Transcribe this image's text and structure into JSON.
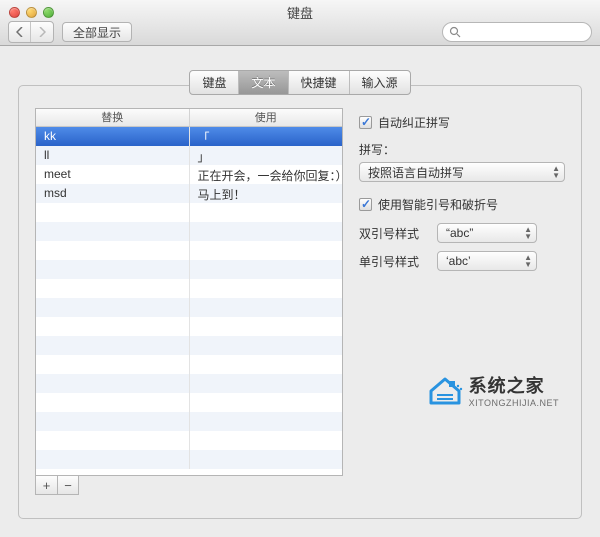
{
  "window": {
    "title": "键盘",
    "showall": "全部显示",
    "search_placeholder": ""
  },
  "tabs": [
    "键盘",
    "文本",
    "快捷键",
    "输入源"
  ],
  "active_tab_index": 1,
  "table": {
    "headers": [
      "替换",
      "使用"
    ],
    "rows": [
      {
        "replace": "kk",
        "use": "「"
      },
      {
        "replace": "ll",
        "use": "」"
      },
      {
        "replace": "meet",
        "use": "正在开会，一会给你回复：）"
      },
      {
        "replace": "msd",
        "use": "马上到！"
      }
    ],
    "selected_index": 0
  },
  "right": {
    "autocorrect_label": "自动纠正拼写",
    "spelling_label": "拼写：",
    "spelling_value": "按照语言自动拼写",
    "smartquotes_label": "使用智能引号和破折号",
    "dq_label": "双引号样式",
    "dq_value": "“abc”",
    "sq_label": "单引号样式",
    "sq_value": "‘abc’"
  },
  "buttons": {
    "plus": "+",
    "minus": "−"
  },
  "watermark": {
    "big": "系统之家",
    "sub": "XITONGZHIJIA.NET"
  }
}
